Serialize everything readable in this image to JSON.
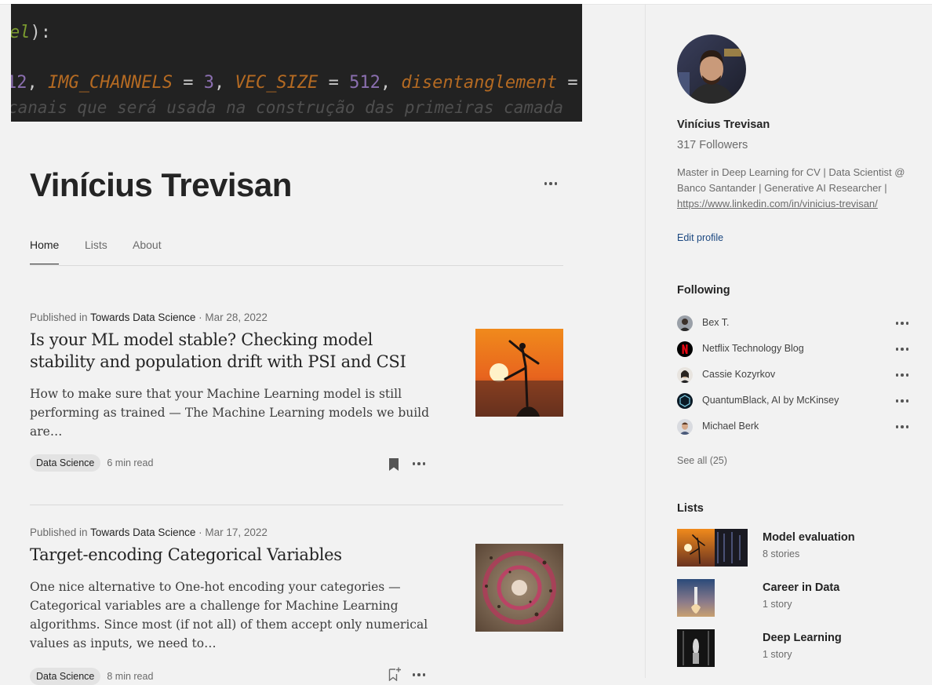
{
  "banner": {
    "line1": {
      "kw": "el",
      "rest": "):"
    },
    "line2": {
      "a": "12",
      "b": ", ",
      "c": "IMG_CHANNELS",
      "d": " = ",
      "e": "3",
      "f": ", ",
      "g": "VEC_SIZE",
      "h": " = ",
      "i": "512",
      "j": ", ",
      "k": "disentanglement",
      "l": " ="
    },
    "line3": "canais que será usada na construção das primeiras camada"
  },
  "profile": {
    "name": "Vinícius Trevisan"
  },
  "tabs": [
    {
      "label": "Home",
      "active": true
    },
    {
      "label": "Lists",
      "active": false
    },
    {
      "label": "About",
      "active": false
    }
  ],
  "articles": [
    {
      "pub_prefix": "Published in ",
      "publication": "Towards Data Science",
      "date": " · Mar 28, 2022",
      "title": "Is your ML model stable? Checking model stability and population drift with PSI and CSI",
      "subtitle": "How to make sure that your Machine Learning model is still performing as trained — The Machine Learning models we build are…",
      "tag": "Data Science",
      "read_time": "6 min read",
      "bookmarked": true
    },
    {
      "pub_prefix": "Published in ",
      "publication": "Towards Data Science",
      "date": " · Mar 17, 2022",
      "title": "Target-encoding Categorical Variables",
      "subtitle": "One nice alternative to One-hot encoding your categories — Categorical variables are a challenge for Machine Learning algorithms. Since most (if not all) of them accept only numerical values as inputs, we need to…",
      "tag": "Data Science",
      "read_time": "8 min read",
      "bookmarked": false
    }
  ],
  "sidebar": {
    "name": "Vinícius Trevisan",
    "followers": "317 Followers",
    "bio_text": "Master in Deep Learning for CV | Data Scientist @ Banco Santander | Generative AI Researcher | ",
    "bio_link": "https://www.linkedin.com/in/vinicius-trevisan/",
    "edit_profile": "Edit profile",
    "following_heading": "Following",
    "following": [
      {
        "name": "Bex T.",
        "icon": "person-avatar"
      },
      {
        "name": "Netflix Technology Blog",
        "icon": "netflix-logo"
      },
      {
        "name": "Cassie Kozyrkov",
        "icon": "person-avatar"
      },
      {
        "name": "QuantumBlack, AI by McKinsey",
        "icon": "quantumblack-logo"
      },
      {
        "name": "Michael Berk",
        "icon": "person-avatar"
      }
    ],
    "see_all": "See all (25)",
    "lists_heading": "Lists",
    "lists": [
      {
        "name": "Model evaluation",
        "count": "8 stories"
      },
      {
        "name": "Career in Data",
        "count": "1 story"
      },
      {
        "name": "Deep Learning",
        "count": "1 story"
      }
    ]
  },
  "colors": {
    "accent_link": "#1a4780",
    "bg": "#f2f2f2",
    "text": "#242424",
    "muted": "#6b6b6b"
  }
}
